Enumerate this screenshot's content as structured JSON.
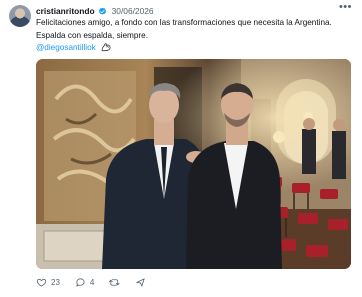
{
  "post": {
    "username": "cristianritondo",
    "date": "30/06/2026",
    "text_line1": "Felicitaciones amigo, a fondo con las transformaciones que necesita la Argentina.",
    "text_line2": "Espalda con espalda, siempre.",
    "mention": "@diegosantilliok",
    "icons": {
      "avatar": "profile-avatar",
      "verified": "verified-badge-icon",
      "more": "more-options-icon",
      "emoji": "flexed-biceps-emoji"
    }
  },
  "actions": {
    "likes": "23",
    "replies": "4",
    "icons": [
      "heart-icon",
      "comment-icon",
      "repost-icon",
      "share-icon"
    ]
  },
  "colors": {
    "link": "#1d9bf0",
    "verified": "#1d9bf0",
    "secondary_text": "#536471"
  }
}
